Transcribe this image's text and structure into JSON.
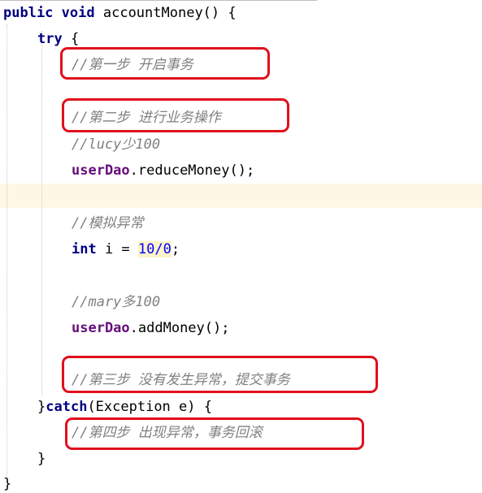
{
  "code": {
    "method_decl": {
      "kw_public": "public",
      "kw_void": "void",
      "rest": " accountMoney() {"
    },
    "try_open": {
      "kw": "try",
      "rest": " {"
    },
    "comment_step1": "//第一步 开启事务",
    "comment_step2": "//第二步 进行业务操作",
    "comment_lucy": "//lucy少100",
    "reduce_call": {
      "field": "userDao",
      "rest": ".reduceMoney();"
    },
    "comment_simulate": "//模拟异常",
    "int_line": {
      "kw": "int",
      "mid": " i = ",
      "num": "10/0",
      "end": ";"
    },
    "comment_mary": "//mary多100",
    "add_call": {
      "field": "userDao",
      "rest": ".addMoney();"
    },
    "comment_step3": "//第三步 没有发生异常，提交事务",
    "catch_line": {
      "brace": "}",
      "kw": "catch",
      "rest": "(Exception e) {"
    },
    "comment_step4": "//第四步 出现异常，事务回滚",
    "catch_close": "}",
    "method_close": "}"
  },
  "colors": {
    "keyword": "#000080",
    "field": "#660e7a",
    "number": "#0000ff",
    "comment": "#808080",
    "annotation_box": "#e0101c",
    "current_line": "#fdf8e4"
  }
}
